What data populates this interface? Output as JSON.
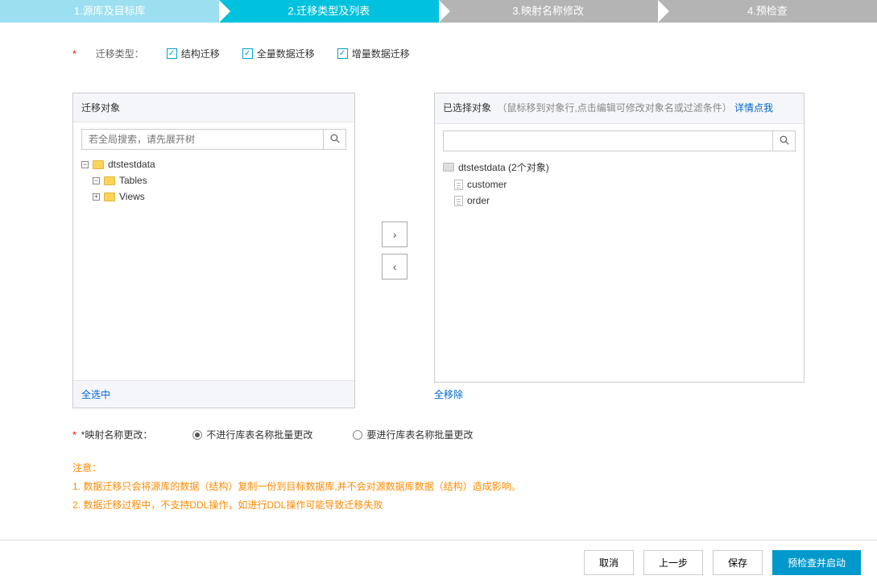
{
  "steps": [
    {
      "label": "1.源库及目标库",
      "state": "done"
    },
    {
      "label": "2.迁移类型及列表",
      "state": "active"
    },
    {
      "label": "3.映射名称修改",
      "state": "pending"
    },
    {
      "label": "4.预检查",
      "state": "pending"
    }
  ],
  "typeRow": {
    "label": "迁移类型：",
    "options": [
      {
        "label": "结构迁移",
        "checked": true
      },
      {
        "label": "全量数据迁移",
        "checked": true
      },
      {
        "label": "增量数据迁移",
        "checked": true
      }
    ]
  },
  "leftPanel": {
    "title": "迁移对象",
    "searchPlaceholder": "若全局搜索，请先展开树",
    "tree": {
      "root": "dtstestdata",
      "children": [
        {
          "label": "Tables"
        },
        {
          "label": "Views"
        }
      ]
    },
    "footerLink": "全选中"
  },
  "rightPanel": {
    "title": "已选择对象",
    "hint": "（鼠标移到对象行,点击编辑可修改对象名或过滤条件）",
    "hintLink": "详情点我",
    "tree": {
      "root": "dtstestdata (2个对象)",
      "children": [
        {
          "label": "customer"
        },
        {
          "label": "order"
        }
      ]
    },
    "footerLink": "全移除"
  },
  "renameRow": {
    "label": "*映射名称更改：",
    "radios": [
      {
        "label": "不进行库表名称批量更改",
        "checked": true
      },
      {
        "label": "要进行库表名称批量更改",
        "checked": false
      }
    ]
  },
  "notes": {
    "heading": "注意：",
    "lines": [
      "1. 数据迁移只会将源库的数据（结构）复制一份到目标数据库,并不会对源数据库数据（结构）造成影响。",
      "2. 数据迁移过程中，不支持DDL操作，如进行DDL操作可能导致迁移失败"
    ]
  },
  "buttons": {
    "cancel": "取消",
    "prev": "上一步",
    "save": "保存",
    "primary": "预检查并启动"
  }
}
